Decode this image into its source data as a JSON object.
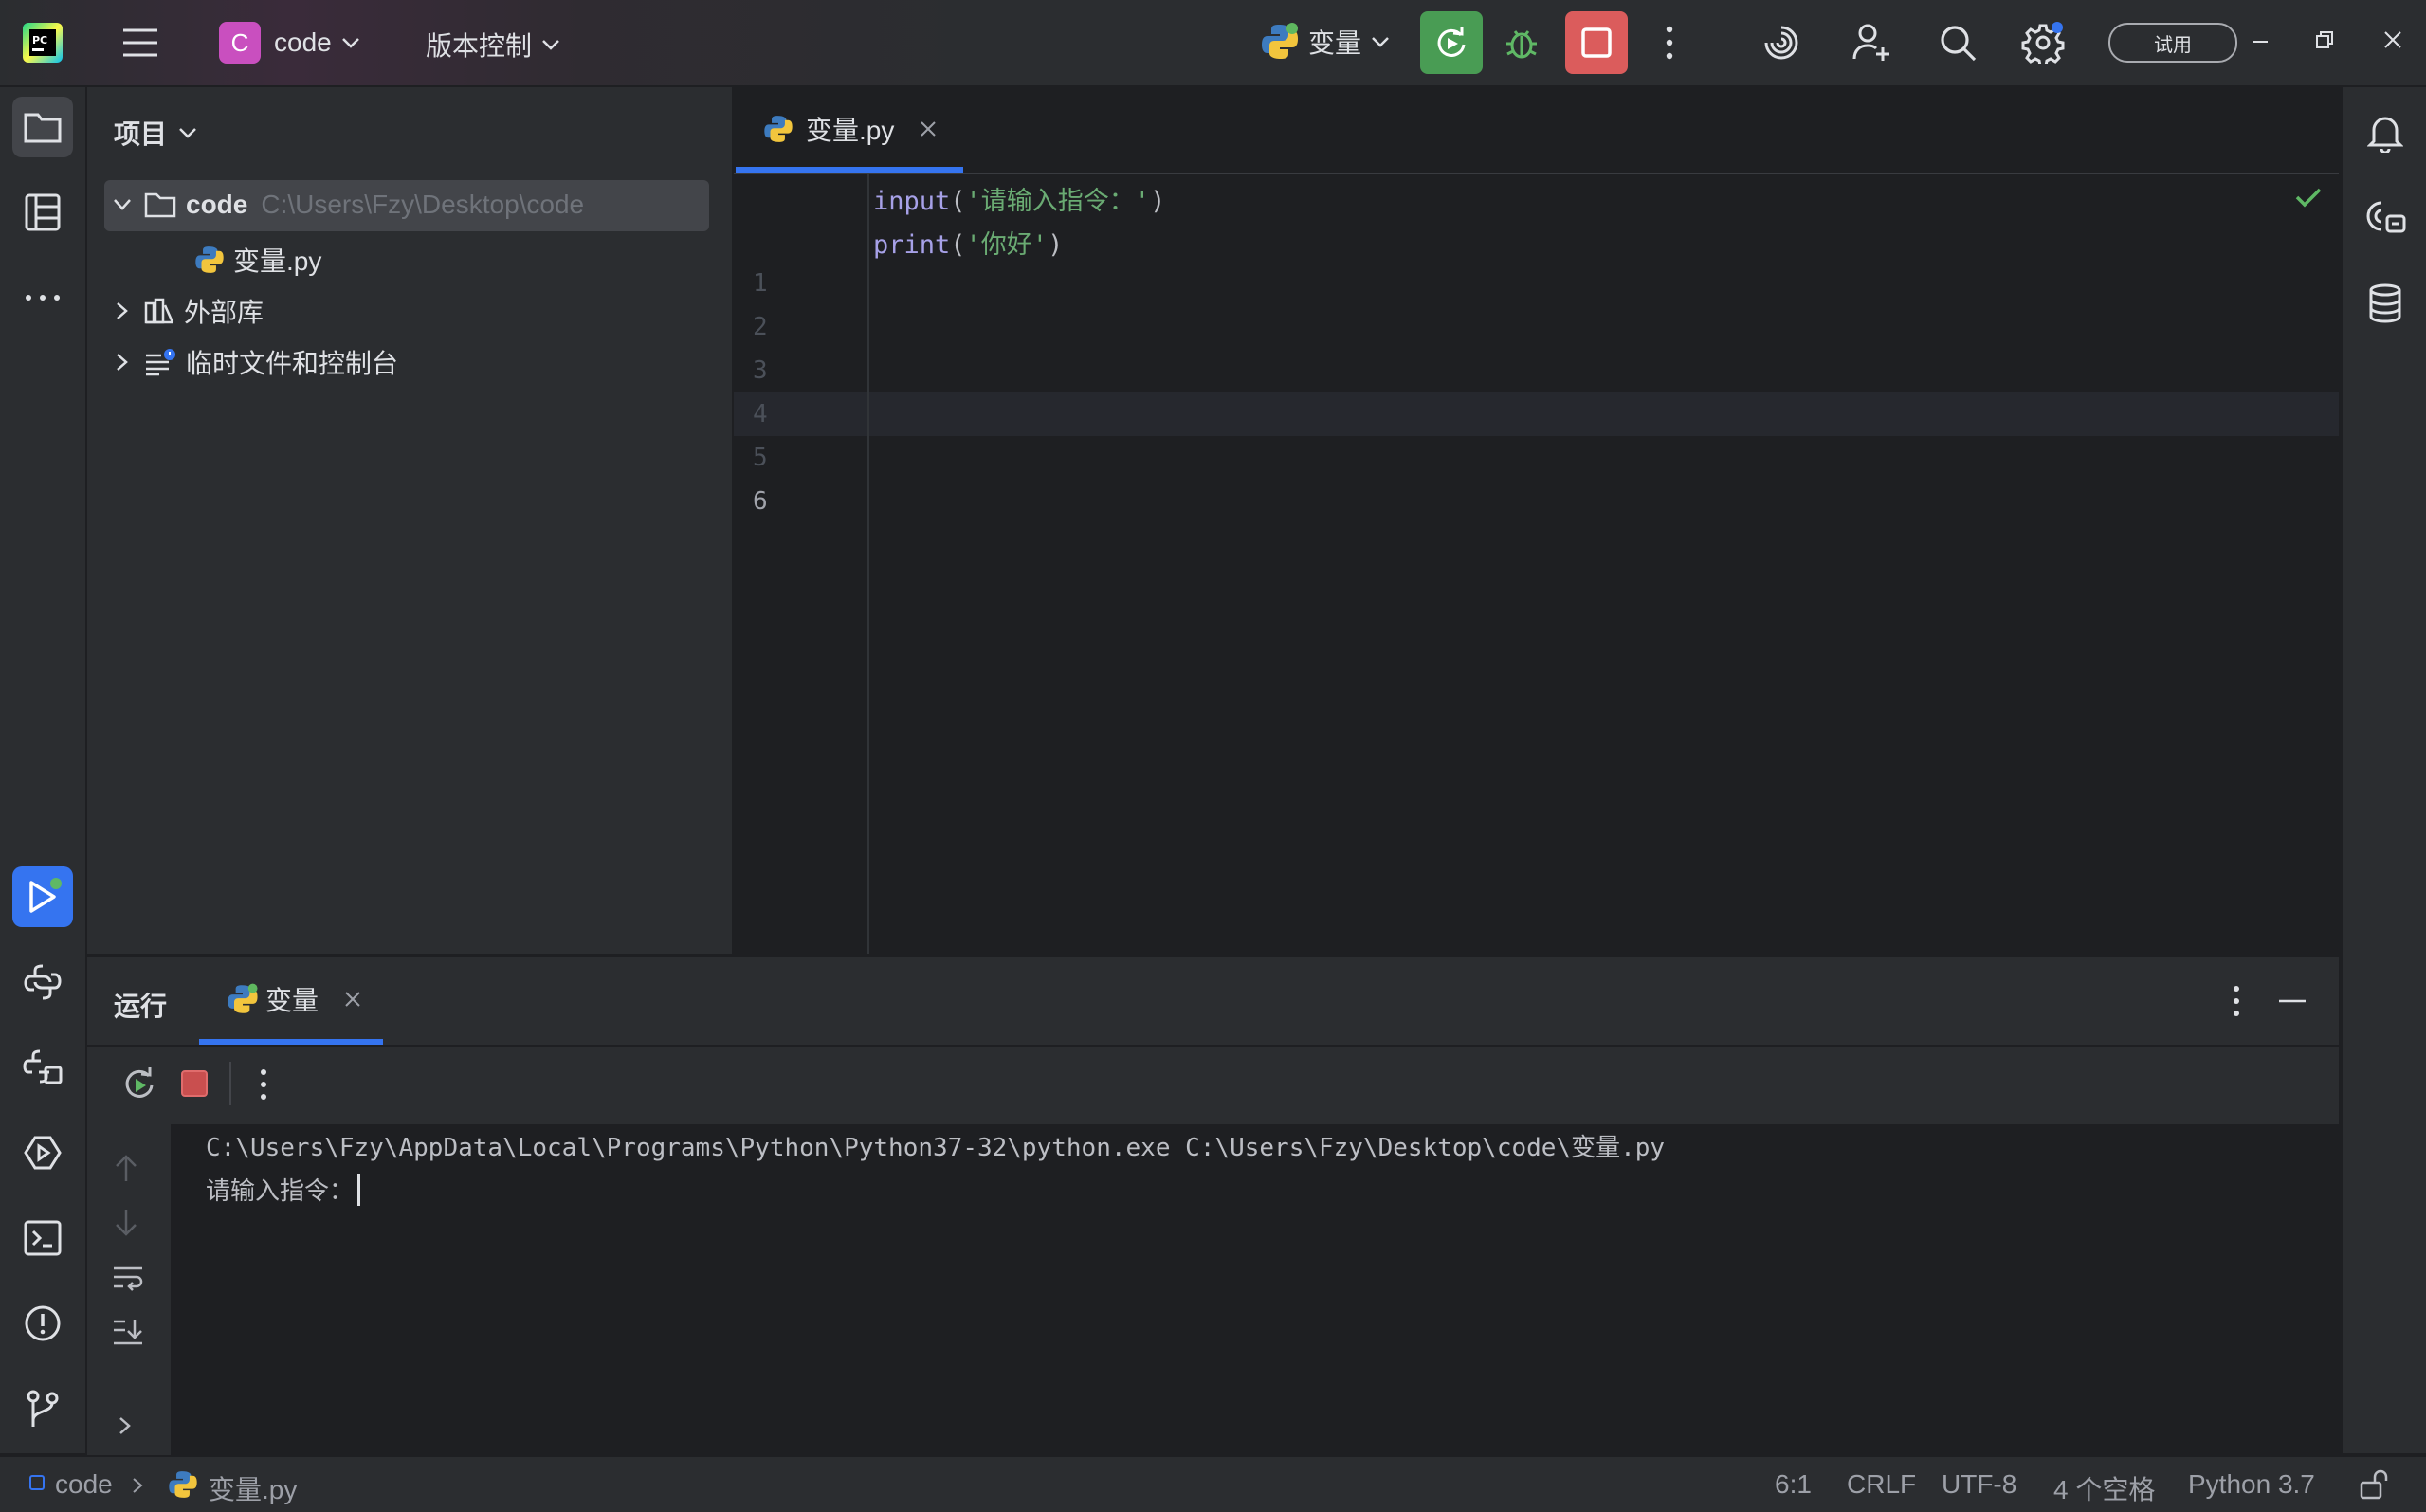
{
  "titlebar": {
    "project_initial": "C",
    "project_name": "code",
    "vcs_label": "版本控制",
    "run_config": "变量",
    "trial_label": "试用"
  },
  "project_panel": {
    "title": "项目",
    "root_name": "code",
    "root_path": "C:\\Users\\Fzy\\Desktop\\code",
    "file_name": "变量.py",
    "external_libs": "外部库",
    "scratches": "临时文件和控制台"
  },
  "editor": {
    "tab_label": "变量.py",
    "line_numbers": [
      "1",
      "2",
      "3",
      "4",
      "5",
      "6"
    ],
    "line1": {
      "fn": "input",
      "open": "(",
      "str": "'请输入指令：'",
      "close": ")"
    },
    "line2": {
      "fn": "print",
      "open": "(",
      "str": "'你好'",
      "close": ")"
    },
    "current_line": 6
  },
  "run_panel": {
    "title": "运行",
    "tab_label": "变量",
    "console_command": "C:\\Users\\Fzy\\AppData\\Local\\Programs\\Python\\Python37-32\\python.exe C:\\Users\\Fzy\\Desktop\\code\\变量.py",
    "console_prompt": "请输入指令："
  },
  "statusbar": {
    "crumb_project": "code",
    "crumb_file": "变量.py",
    "position": "6:1",
    "line_sep": "CRLF",
    "encoding": "UTF-8",
    "indent": "4 个空格",
    "interpreter": "Python 3.7"
  },
  "colors": {
    "accent": "#3574f0",
    "run_green": "#499c54",
    "stop_red": "#db5c5c",
    "project_badge": "#c94fbf"
  }
}
